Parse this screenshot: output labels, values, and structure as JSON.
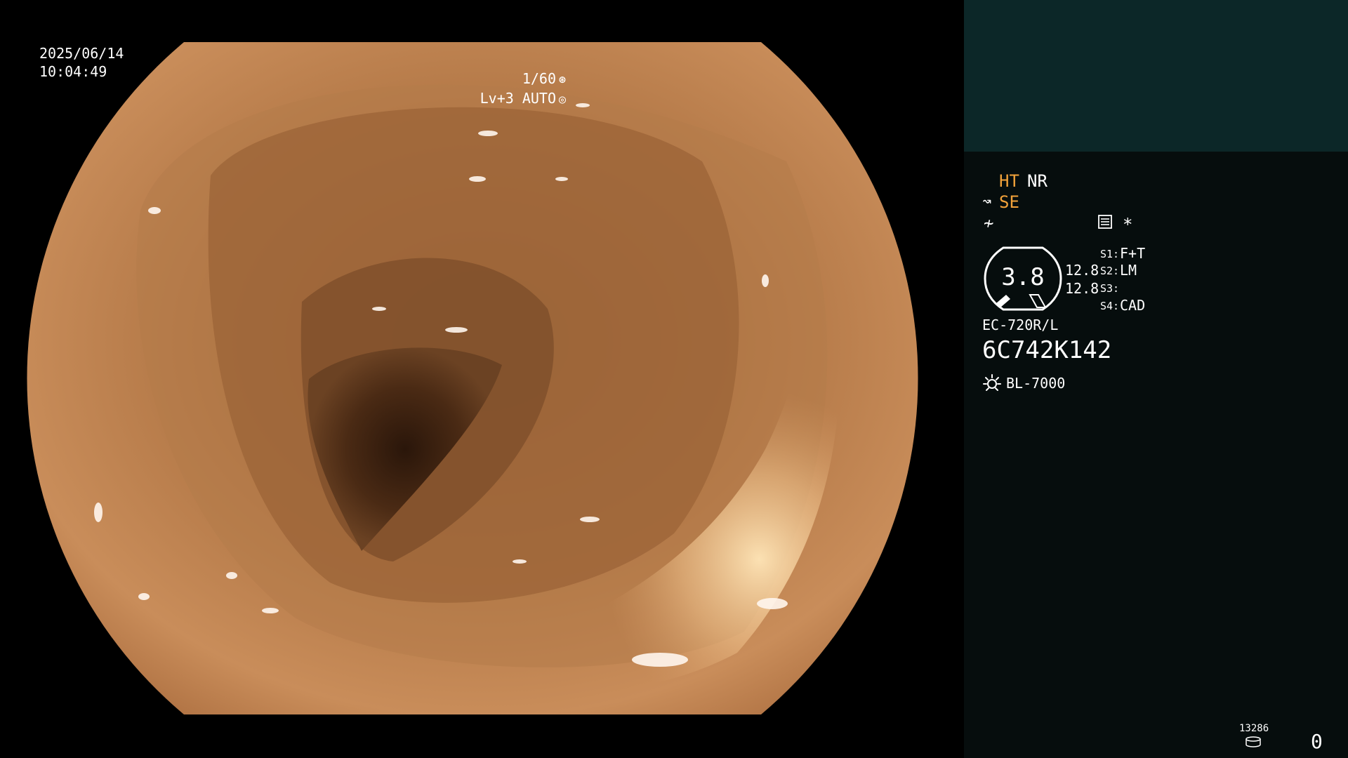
{
  "view": {
    "date": "2025/06/14",
    "time": "10:04:49",
    "shutter": "1/60",
    "shutter_icon": "iris-icon",
    "level": "Lv+3 AUTO",
    "level_icon": "auto-brightness-icon"
  },
  "panel": {
    "ht": "HT",
    "nr": "NR",
    "se": "SE",
    "se_icon": "structure-enhance-icon",
    "freeze_icon": "freeze-icon",
    "record_icon": "record-settings-icon",
    "star": "*",
    "gauge_value": "3.8",
    "gauge_side_1": "12.8",
    "gauge_side_2": "12.8",
    "switches": [
      {
        "label": "S1:",
        "value": "F+T"
      },
      {
        "label": "S2:",
        "value": "LM"
      },
      {
        "label": "S3:",
        "value": ""
      },
      {
        "label": "S4:",
        "value": "CAD"
      }
    ],
    "scope_model": "EC-720R/L",
    "scope_serial": "6C742K142",
    "light_source": "BL-7000",
    "light_icon": "light-source-icon",
    "counter": "13286",
    "counter_icon": "storage-icon",
    "count_zero": "0"
  },
  "colors": {
    "panel_bg": "#060d0d",
    "panel_top_bg": "#0c2728",
    "accent_orange": "#f2a23a"
  }
}
